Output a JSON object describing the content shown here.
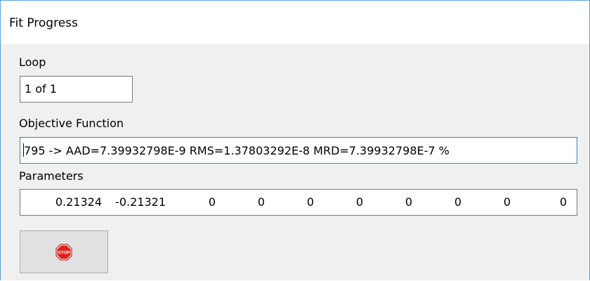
{
  "window": {
    "title": "Fit Progress"
  },
  "loop": {
    "label": "Loop",
    "value": "1 of 1"
  },
  "objective": {
    "label": "Objective Function",
    "value": "795 -> AAD=7.39932798E-9 RMS=1.37803292E-8 MRD=7.39932798E-7 %"
  },
  "parameters": {
    "label": "Parameters",
    "values": [
      "0.21324",
      "-0.21321",
      "0",
      "0",
      "0",
      "0",
      "0",
      "0",
      "0",
      "0"
    ]
  },
  "stop_button": {
    "icon": "stop-sign-icon",
    "icon_text": "STOP",
    "icon_color": "#e0201b"
  }
}
